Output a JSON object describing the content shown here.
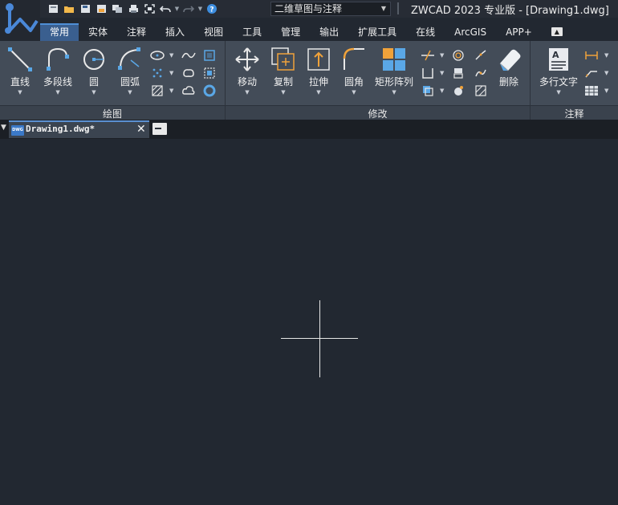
{
  "quick_access": {
    "icons": [
      "new-file-icon",
      "open-folder-icon",
      "save-icon",
      "save-as-icon",
      "sheet-set-icon",
      "print-icon",
      "zoom-extents-icon",
      "undo-icon",
      "redo-icon",
      "help-icon"
    ],
    "workspace": "二维草图与注释"
  },
  "window": {
    "title": "ZWCAD 2023 专业版 - [Drawing1.dwg]"
  },
  "ribbon": {
    "tabs": [
      "常用",
      "实体",
      "注释",
      "插入",
      "视图",
      "工具",
      "管理",
      "输出",
      "扩展工具",
      "在线",
      "ArcGIS",
      "APP+"
    ],
    "active_tab": "常用",
    "panels": {
      "draw": {
        "label": "绘图",
        "tools": [
          {
            "name": "line",
            "label": "直线"
          },
          {
            "name": "polyline",
            "label": "多段线"
          },
          {
            "name": "circle",
            "label": "圆"
          },
          {
            "name": "arc",
            "label": "圆弧"
          }
        ]
      },
      "modify": {
        "label": "修改",
        "tools": [
          {
            "name": "move",
            "label": "移动"
          },
          {
            "name": "copy",
            "label": "复制"
          },
          {
            "name": "stretch",
            "label": "拉伸"
          },
          {
            "name": "fillet",
            "label": "圆角"
          },
          {
            "name": "rect-array",
            "label": "矩形阵列"
          },
          {
            "name": "erase",
            "label": "删除"
          }
        ]
      },
      "annotation": {
        "label": "注释",
        "tools": [
          {
            "name": "mtext",
            "label": "多行文字"
          }
        ]
      }
    }
  },
  "document": {
    "tab_name": "Drawing1.dwg*",
    "file_badge": "DWG"
  },
  "colors": {
    "accent": "#3a5f8f",
    "ribbon_bg": "#434c58",
    "canvas_bg": "#222831",
    "icon_blue": "#5aa7e6",
    "icon_orange": "#f0a23a"
  }
}
